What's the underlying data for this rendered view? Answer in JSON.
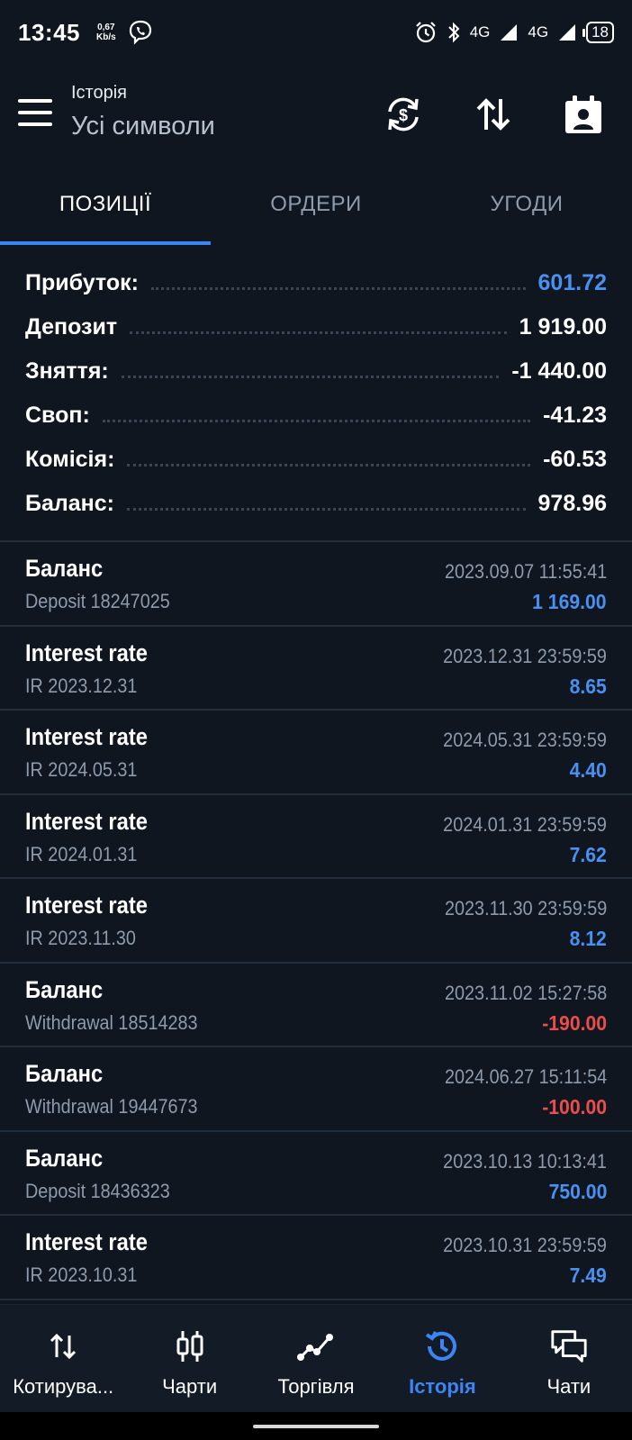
{
  "status_bar": {
    "time": "13:45",
    "speed_value": "0,67",
    "speed_unit": "Kb/s",
    "network1": "4G",
    "network2": "4G",
    "battery": "18"
  },
  "header": {
    "title": "Історія",
    "subtitle": "Усі символи"
  },
  "tabs": [
    {
      "label": "ПОЗИЦІЇ",
      "active": true
    },
    {
      "label": "ОРДЕРИ",
      "active": false
    },
    {
      "label": "УГОДИ",
      "active": false
    }
  ],
  "summary": [
    {
      "label": "Прибуток:",
      "value": "601.72"
    },
    {
      "label": "Депозит",
      "value": "1 919.00"
    },
    {
      "label": "Зняття:",
      "value": "-1 440.00"
    },
    {
      "label": "Своп:",
      "value": "-41.23"
    },
    {
      "label": "Комісія:",
      "value": "-60.53"
    },
    {
      "label": "Баланс:",
      "value": "978.96"
    }
  ],
  "deals": [
    {
      "title": "Баланс",
      "comment": "Deposit 18247025",
      "time": "2023.09.07 11:55:41",
      "amount": "1 169.00",
      "sign": "pos"
    },
    {
      "title": "Interest rate",
      "comment": "IR 2023.12.31",
      "time": "2023.12.31 23:59:59",
      "amount": "8.65",
      "sign": "pos"
    },
    {
      "title": "Interest rate",
      "comment": "IR 2024.05.31",
      "time": "2024.05.31 23:59:59",
      "amount": "4.40",
      "sign": "pos"
    },
    {
      "title": "Interest rate",
      "comment": "IR 2024.01.31",
      "time": "2024.01.31 23:59:59",
      "amount": "7.62",
      "sign": "pos"
    },
    {
      "title": "Interest rate",
      "comment": "IR 2023.11.30",
      "time": "2023.11.30 23:59:59",
      "amount": "8.12",
      "sign": "pos"
    },
    {
      "title": "Баланс",
      "comment": "Withdrawal 18514283",
      "time": "2023.11.02 15:27:58",
      "amount": "-190.00",
      "sign": "neg"
    },
    {
      "title": "Баланс",
      "comment": "Withdrawal 19447673",
      "time": "2024.06.27 15:11:54",
      "amount": "-100.00",
      "sign": "neg"
    },
    {
      "title": "Баланс",
      "comment": "Deposit 18436323",
      "time": "2023.10.13 10:13:41",
      "amount": "750.00",
      "sign": "pos"
    },
    {
      "title": "Interest rate",
      "comment": "IR 2023.10.31",
      "time": "2023.10.31 23:59:59",
      "amount": "7.49",
      "sign": "pos"
    }
  ],
  "bottom_nav": [
    {
      "label": "Котирува...",
      "icon": "quotes-arrows-icon",
      "active": false
    },
    {
      "label": "Чарти",
      "icon": "candlestick-chart-icon",
      "active": false
    },
    {
      "label": "Торгівля",
      "icon": "trade-line-icon",
      "active": false
    },
    {
      "label": "Історія",
      "icon": "history-clock-icon",
      "active": true
    },
    {
      "label": "Чати",
      "icon": "chat-bubbles-icon",
      "active": false
    }
  ],
  "colors": {
    "background": "#0f1620",
    "accent": "#3d85f5",
    "positive": "#4a90f0",
    "negative": "#eb4d4d",
    "muted_text": "#8e9bab"
  }
}
